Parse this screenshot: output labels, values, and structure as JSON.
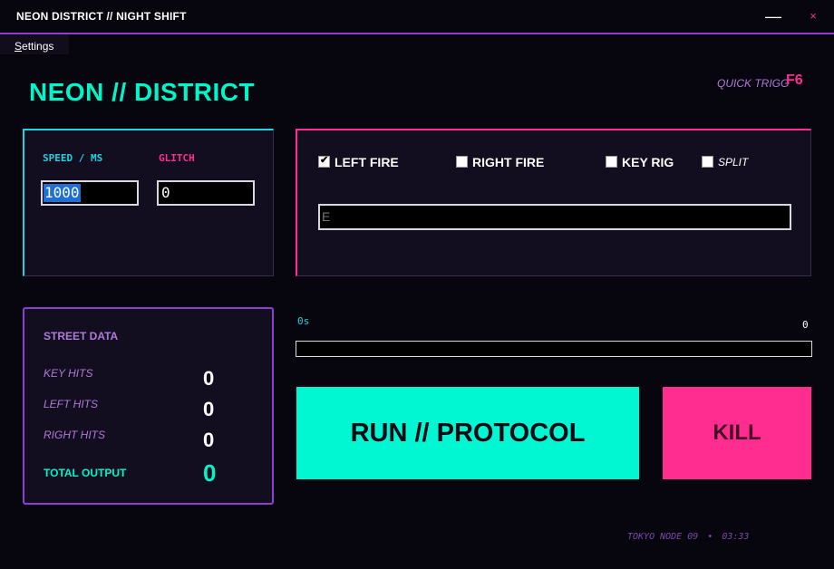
{
  "window": {
    "title": "NEON DISTRICT  //  NIGHT SHIFT",
    "minimize": "—",
    "close": "×"
  },
  "menu": {
    "settings": "Settings"
  },
  "header": {
    "brand": "NEON // DISTRICT",
    "quick_trigger_label": "QUICK TRIGG",
    "quick_trigger_key": "F6"
  },
  "timing": {
    "speed_label": "SPEED / MS",
    "speed_value": "1000",
    "glitch_label": "GLITCH",
    "glitch_value": "0"
  },
  "options": {
    "left_fire": {
      "label": "LEFT FIRE",
      "checked": true
    },
    "right_fire": {
      "label": "RIGHT FIRE",
      "checked": false
    },
    "key_rig": {
      "label": "KEY RIG",
      "checked": false
    },
    "split": {
      "label": "SPLIT",
      "checked": false
    },
    "key_placeholder": "E"
  },
  "stats": {
    "title": "STREET DATA",
    "key_hits_label": "KEY HITS",
    "key_hits": "0",
    "left_hits_label": "LEFT HITS",
    "left_hits": "0",
    "right_hits_label": "RIGHT HITS",
    "right_hits": "0",
    "total_label": "TOTAL OUTPUT",
    "total": "0"
  },
  "run": {
    "timer": "0s",
    "count": "0",
    "progress": 0
  },
  "buttons": {
    "run": "RUN // PROTOCOL",
    "kill": "KILL"
  },
  "footer": {
    "node": "TOKYO NODE 09",
    "separator": "•",
    "time": "03:33"
  },
  "colors": {
    "cyan": "#00f5c8",
    "pink": "#ff2d8f",
    "purple": "#8a3fd0",
    "background": "#07050e"
  }
}
